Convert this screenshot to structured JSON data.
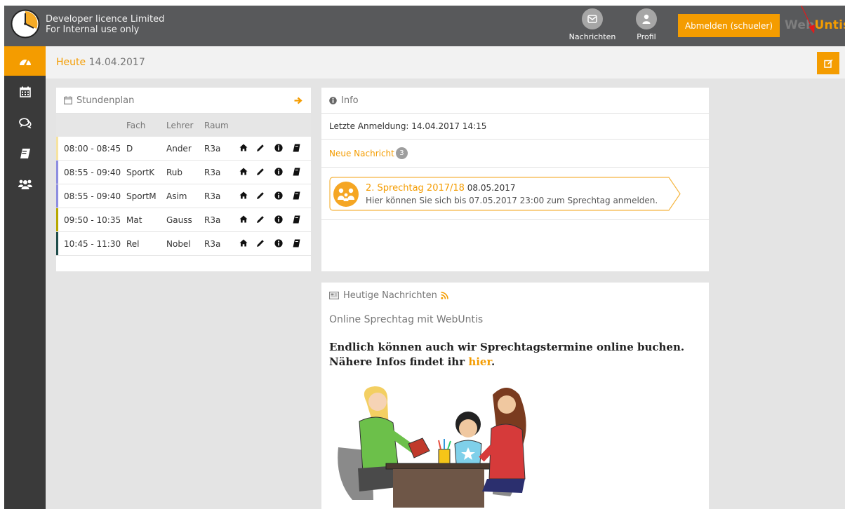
{
  "header": {
    "licence_line1": "Developer licence Limited",
    "licence_line2": "For Internal use only",
    "messages_label": "Nachrichten",
    "profile_label": "Profil",
    "logout_label": "Abmelden (schueler)",
    "brand_web": "Web",
    "brand_untis": "Untis"
  },
  "page": {
    "title_label": "Heute",
    "title_date": "14.04.2017"
  },
  "sidebar": {
    "items": [
      "dashboard-icon",
      "calendar-icon",
      "comments-icon",
      "book-icon",
      "group-icon"
    ]
  },
  "timetable": {
    "title": "Stundenplan",
    "columns": [
      "Fach",
      "Lehrer",
      "Raum"
    ],
    "rows": [
      {
        "time": "08:00 - 08:45",
        "subject": "D",
        "teacher": "Ander",
        "room": "R3a",
        "color": "#f6e3a1"
      },
      {
        "time": "08:55 - 09:40",
        "subject": "SportK",
        "teacher": "Rub",
        "room": "R3a",
        "color": "#8d8ee0"
      },
      {
        "time": "08:55 - 09:40",
        "subject": "SportM",
        "teacher": "Asim",
        "room": "R3a",
        "color": "#8d8ee0"
      },
      {
        "time": "09:50 - 10:35",
        "subject": "Mat",
        "teacher": "Gauss",
        "room": "R3a",
        "color": "#b7a800"
      },
      {
        "time": "10:45 - 11:30",
        "subject": "Rel",
        "teacher": "Nobel",
        "room": "R3a",
        "color": "#1f4d4a"
      }
    ]
  },
  "info": {
    "title": "Info",
    "last_login": "Letzte Anmeldung: 14.04.2017 14:15",
    "new_message_label": "Neue Nachricht",
    "new_message_count": "3",
    "event_title": "2. Sprechtag 2017/18",
    "event_date": "08.05.2017",
    "event_text": "Hier können Sie sich bis 07.05.2017 23:00 zum Sprechtag anmelden."
  },
  "news": {
    "title": "Heutige Nachrichten",
    "subject": "Online Sprechtag mit WebUntis",
    "body_text": "Endlich können auch wir Sprechtagstermine online buchen. Nähere Infos findet ihr ",
    "body_link": "hier",
    "body_end": "."
  },
  "colors": {
    "accent": "#f49c00",
    "topbar": "#58595b",
    "sidebar": "#3a3a3a"
  }
}
